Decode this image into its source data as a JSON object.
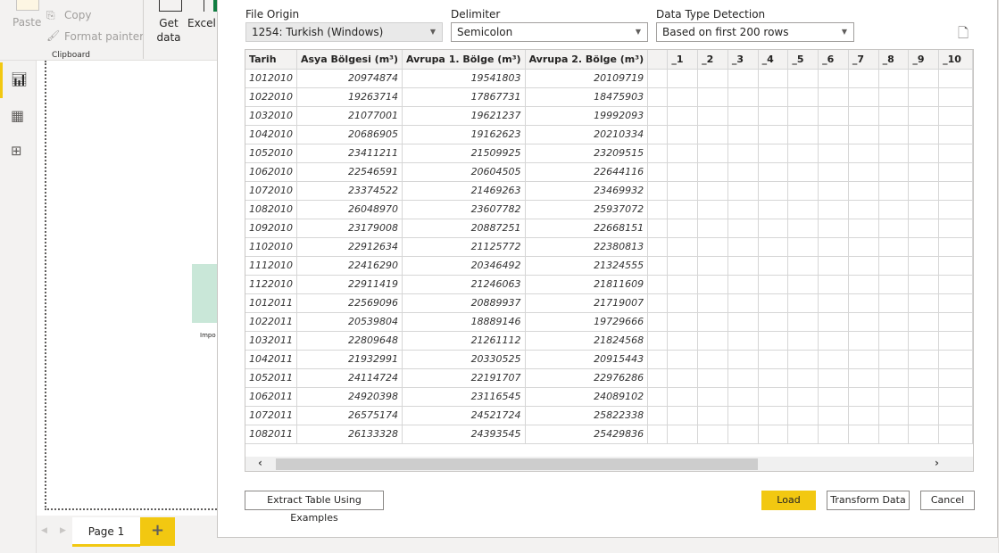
{
  "ribbon": {
    "paste": "Paste",
    "copy": "Copy",
    "format_painter": "Format painter",
    "clipboard": "Clipboard",
    "get_data": "Get data",
    "excel": "Excel workbook"
  },
  "canvas": {
    "visual_label": "Impo"
  },
  "pages": {
    "tab": "Page 1",
    "add": "+"
  },
  "dialog": {
    "file_origin_label": "File Origin",
    "file_origin_value": "1254: Turkish (Windows)",
    "delimiter_label": "Delimiter",
    "delimiter_value": "Semicolon",
    "detection_label": "Data Type Detection",
    "detection_value": "Based on first 200 rows",
    "extract_button": "Extract Table Using Examples",
    "load_button": "Load",
    "transform_button": "Transform Data",
    "cancel_button": "Cancel",
    "accent": "#f2c811"
  },
  "table": {
    "headers": [
      "Tarih",
      "Asya Bölgesi (m³)",
      "Avrupa 1. Bölge (m³)",
      "Avrupa 2. Bölge (m³)",
      "",
      "_1",
      "_2",
      "_3",
      "_4",
      "_5",
      "_6",
      "_7",
      "_8",
      "_9",
      "_10"
    ],
    "rows": [
      [
        "1012010",
        "20974874",
        "19541803",
        "20109719"
      ],
      [
        "1022010",
        "19263714",
        "17867731",
        "18475903"
      ],
      [
        "1032010",
        "21077001",
        "19621237",
        "19992093"
      ],
      [
        "1042010",
        "20686905",
        "19162623",
        "20210334"
      ],
      [
        "1052010",
        "23411211",
        "21509925",
        "23209515"
      ],
      [
        "1062010",
        "22546591",
        "20604505",
        "22644116"
      ],
      [
        "1072010",
        "23374522",
        "21469263",
        "23469932"
      ],
      [
        "1082010",
        "26048970",
        "23607782",
        "25937072"
      ],
      [
        "1092010",
        "23179008",
        "20887251",
        "22668151"
      ],
      [
        "1102010",
        "22912634",
        "21125772",
        "22380813"
      ],
      [
        "1112010",
        "22416290",
        "20346492",
        "21324555"
      ],
      [
        "1122010",
        "22911419",
        "21246063",
        "21811609"
      ],
      [
        "1012011",
        "22569096",
        "20889937",
        "21719007"
      ],
      [
        "1022011",
        "20539804",
        "18889146",
        "19729666"
      ],
      [
        "1032011",
        "22809648",
        "21261112",
        "21824568"
      ],
      [
        "1042011",
        "21932991",
        "20330525",
        "20915443"
      ],
      [
        "1052011",
        "24114724",
        "22191707",
        "22976286"
      ],
      [
        "1062011",
        "24920398",
        "23116545",
        "24089102"
      ],
      [
        "1072011",
        "26575174",
        "24521724",
        "25822338"
      ],
      [
        "1082011",
        "26133328",
        "24393545",
        "25429836"
      ]
    ]
  }
}
